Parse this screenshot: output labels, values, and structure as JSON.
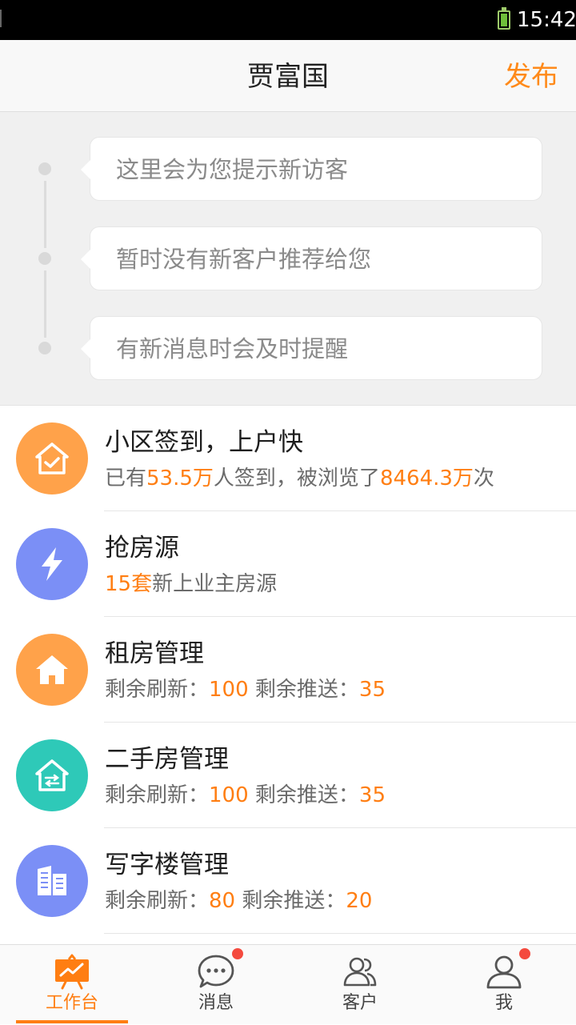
{
  "status_bar": {
    "time": "15:42"
  },
  "header": {
    "title": "贾富国",
    "action": "发布"
  },
  "timeline": {
    "items": [
      "这里会为您提示新访客",
      "暂时没有新客户推荐给您",
      "有新消息时会及时提醒"
    ]
  },
  "list": [
    {
      "title": "小区签到，上户快",
      "icon": "house-check-icon",
      "color": "#ffa24a",
      "sub": [
        "已有",
        "53.5万",
        "人签到，被浏览了",
        "8464.3万",
        "次"
      ]
    },
    {
      "title": "抢房源",
      "icon": "lightning-icon",
      "color": "#7b8ff6",
      "sub": [
        "15套",
        "新上业主房源"
      ]
    },
    {
      "title": "租房管理",
      "icon": "house-icon",
      "color": "#ffa24a",
      "sub": [
        "剩余刷新：",
        "100",
        " 剩余推送：",
        "35"
      ]
    },
    {
      "title": "二手房管理",
      "icon": "house-exchange-icon",
      "color": "#2ec9b8",
      "sub": [
        "剩余刷新：",
        "100",
        " 剩余推送：",
        "35"
      ]
    },
    {
      "title": "写字楼管理",
      "icon": "office-building-icon",
      "color": "#7b8ff6",
      "sub": [
        "剩余刷新：",
        "80",
        " 剩余推送：",
        "20"
      ]
    }
  ],
  "tabs": [
    {
      "label": "工作台",
      "icon": "workbench-chart-icon",
      "active": true
    },
    {
      "label": "消息",
      "icon": "chat-bubble-icon",
      "badge": true
    },
    {
      "label": "客户",
      "icon": "customers-icon"
    },
    {
      "label": "我",
      "icon": "profile-icon",
      "badge": true
    }
  ],
  "colors": {
    "accent": "#ff7e12",
    "badge": "#f44a3e"
  }
}
